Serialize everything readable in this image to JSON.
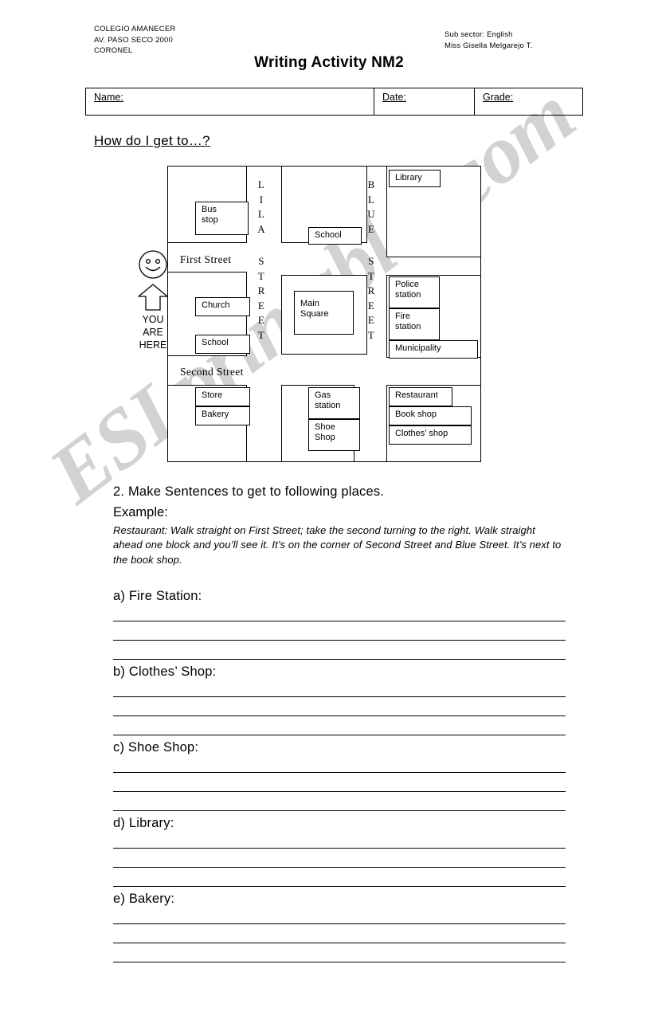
{
  "header": {
    "school_lines": [
      "COLEGIO AMANECER",
      "AV. PASO SECO 2000",
      "CORONEL"
    ],
    "subject_lines": [
      "Sub sector: English",
      "Miss Gisella Melgarejo T."
    ],
    "title": "Writing Activity NM2"
  },
  "id_fields": {
    "name_label": "Name:",
    "date_label": "Date:",
    "grade_label": "Grade:"
  },
  "prompt_heading": "How do I get to…?",
  "map": {
    "you_are_here": "YOU\nARE\nHERE",
    "streets": {
      "first": "First Street",
      "second": "Second Street",
      "lila": "LILA",
      "lila_suffix": "STREET",
      "blue": "BLUE",
      "blue_suffix": "STREET"
    },
    "places": {
      "bus_stop": "Bus\nstop",
      "school_top": "School",
      "library": "Library",
      "church": "Church",
      "school_mid": "School",
      "main_square": "Main\nSquare",
      "police_station": "Police\nstation",
      "fire_station": "Fire\nstation",
      "municipality": "Municipality",
      "store": "Store",
      "bakery": "Bakery",
      "gas_station": "Gas\nstation",
      "shoe_shop": "Shoe\nShop",
      "restaurant": "Restaurant",
      "book_shop": "Book shop",
      "clothes_shop": "Clothes’ shop"
    }
  },
  "exercise": {
    "instruction": "2.  Make Sentences to get to following places.",
    "example_label": "Example:",
    "example_text": "Restaurant: Walk straight on First Street; take the second turning to the right. Walk straight ahead one block and you’ll see it. It’s on the corner of Second Street and Blue Street. It’s next to the book shop.",
    "questions": [
      {
        "label": "a) Fire Station:"
      },
      {
        "label": "b) Clothes’ Shop:"
      },
      {
        "label": "c) Shoe Shop:"
      },
      {
        "label": "d) Library:"
      },
      {
        "label": "e) Bakery:"
      }
    ]
  },
  "watermark": {
    "text": "ESLprintables.com",
    "color": "#d2d2d2"
  }
}
